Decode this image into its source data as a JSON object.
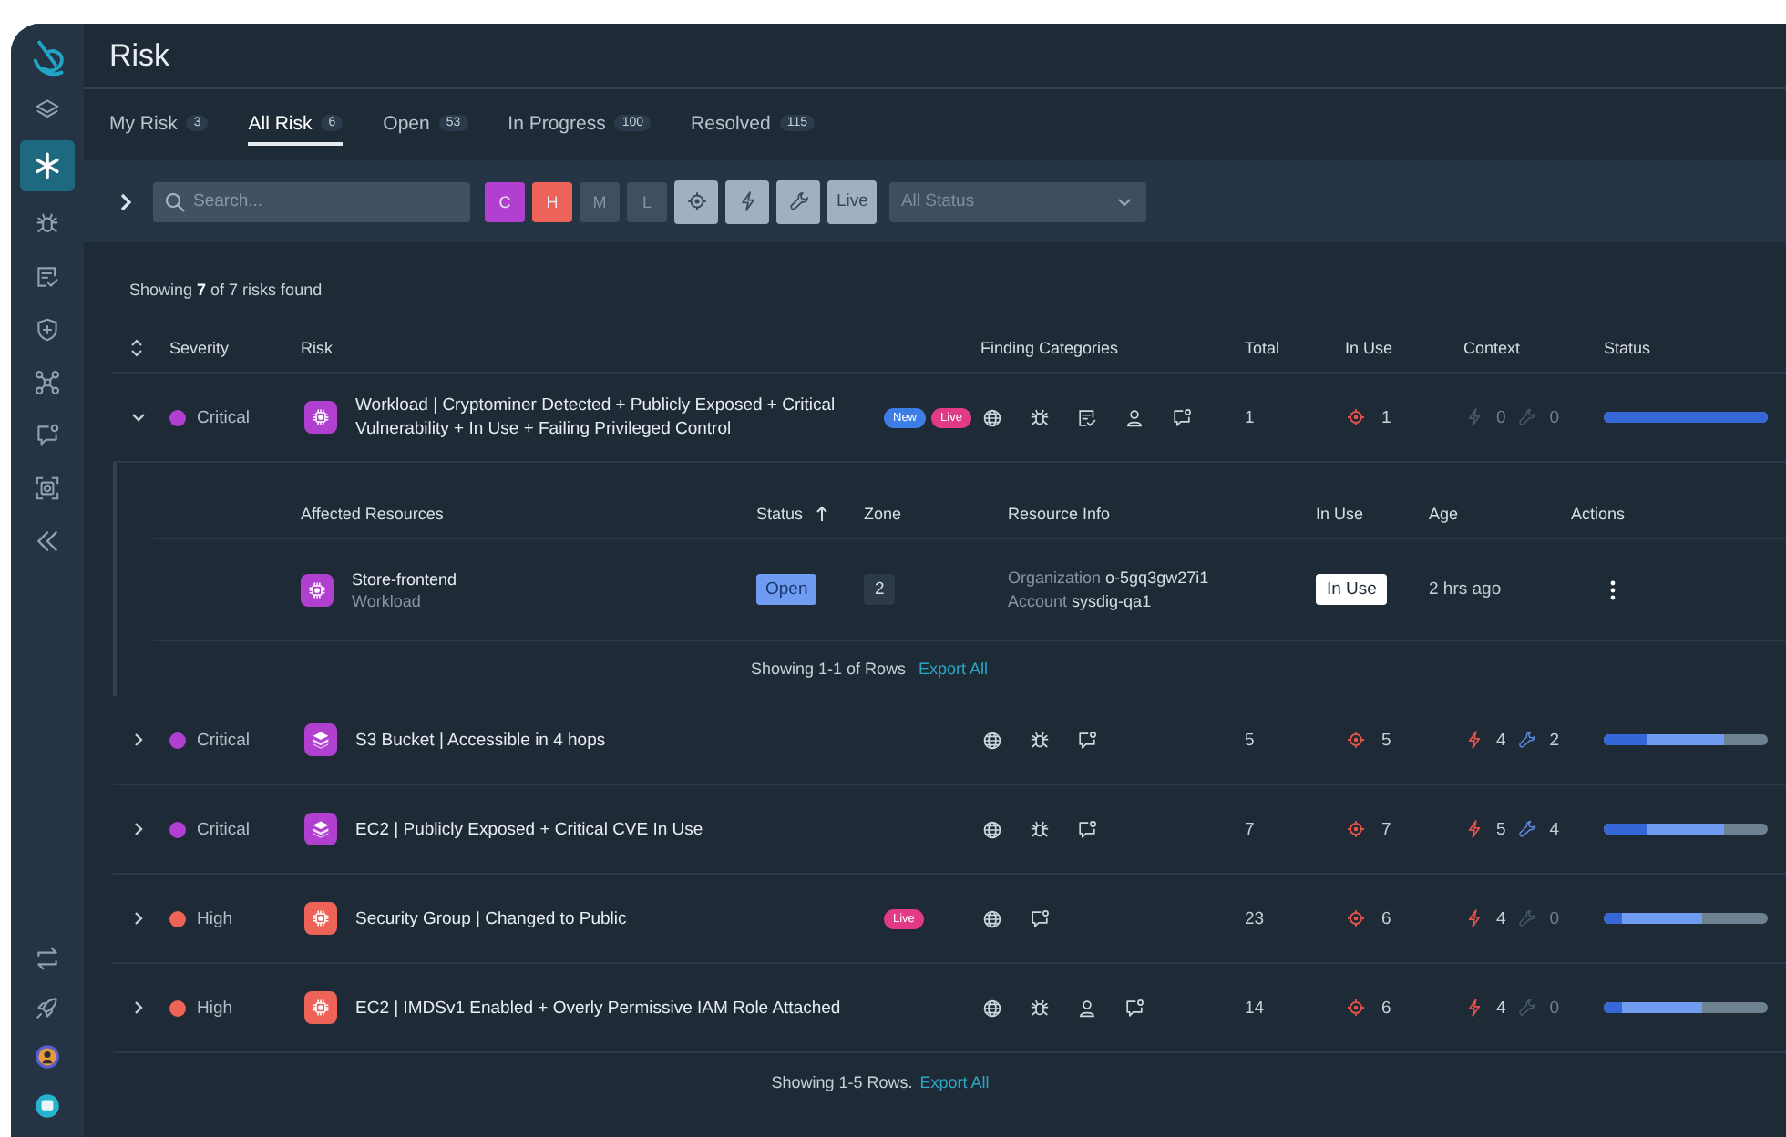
{
  "sidebar": {
    "top_items": [
      {
        "kind": "logo",
        "selected": false
      },
      {
        "kind": "layers",
        "selected": false
      },
      {
        "kind": "asterisk",
        "selected": true
      },
      {
        "kind": "bug",
        "selected": false
      },
      {
        "kind": "checklist",
        "selected": false
      },
      {
        "kind": "shield",
        "selected": false
      },
      {
        "kind": "network",
        "selected": false
      },
      {
        "kind": "chat",
        "selected": false
      },
      {
        "kind": "scan",
        "selected": false
      },
      {
        "kind": "collapse",
        "selected": false
      }
    ],
    "bottom_items": [
      {
        "kind": "swap",
        "selected": false
      },
      {
        "kind": "rocket",
        "selected": false
      },
      {
        "kind": "avatar",
        "selected": false
      },
      {
        "kind": "help",
        "selected": false
      }
    ]
  },
  "page": {
    "title": "Risk"
  },
  "tabs": [
    {
      "label": "My Risk",
      "count": "3",
      "selected": false
    },
    {
      "label": "All Risk",
      "count": "6",
      "selected": true
    },
    {
      "label": "Open",
      "count": "53",
      "selected": false
    },
    {
      "label": "In Progress",
      "count": "100",
      "selected": false
    },
    {
      "label": "Resolved",
      "count": "115",
      "selected": false
    }
  ],
  "filters": {
    "search": {
      "placeholder": "Search..."
    },
    "severity": [
      {
        "label": "C",
        "color": "#b140d0",
        "selected": true
      },
      {
        "label": "H",
        "color": "#ee6357",
        "selected": true
      },
      {
        "label": "M",
        "color": "#3f4f61",
        "selected": false
      },
      {
        "label": "L",
        "color": "#3f4f61",
        "selected": false
      }
    ],
    "toggles": [
      {
        "kind": "target",
        "selected": true
      },
      {
        "kind": "bolt",
        "selected": true
      },
      {
        "kind": "wrench",
        "selected": true
      },
      {
        "kind": "text",
        "label": "Live",
        "selected": true
      }
    ],
    "status": {
      "placeholder": "All Status"
    }
  },
  "summary": {
    "text": "Showing **7** of 7 risks found"
  },
  "table": {
    "columns": [
      "Severity",
      "Risk",
      "Finding Categories",
      "Total",
      "In Use",
      "Context",
      "Status"
    ],
    "rows": [
      {
        "expanded": true,
        "severity": "Critical",
        "color": "#b140d0",
        "kind": "chip",
        "title": "Workload | Cryptominer Detected + Publicly Exposed + Critical Vulnerability + In Use + Failing Privileged Control",
        "badges": [
          {
            "kind": "new",
            "label": "New"
          },
          {
            "kind": "live",
            "label": "Live"
          }
        ],
        "categories": [
          {
            "kind": "globe"
          },
          {
            "kind": "bug"
          },
          {
            "kind": "checklist"
          },
          {
            "kind": "person"
          },
          {
            "kind": "chat"
          }
        ],
        "total": "1",
        "in_use": "1",
        "context": [
          {
            "kind": "bolt",
            "count": "0",
            "active": false
          },
          {
            "kind": "wrench",
            "count": "0",
            "active": false
          }
        ],
        "status": [
          {
            "level": 1.0
          },
          {
            "level": 1.0
          }
        ],
        "details": {
          "columns": [
            {
              "label": "Affected Resources",
              "sorted": false
            },
            {
              "label": "Status",
              "sorted": true
            },
            {
              "label": "Zone",
              "sorted": false
            },
            {
              "label": "Resource Info",
              "sorted": false
            },
            {
              "label": "In Use",
              "sorted": false
            },
            {
              "label": "Age",
              "sorted": false
            },
            {
              "label": "Actions",
              "sorted": false
            }
          ],
          "rows": [
            {
              "name": "Store-frontend",
              "type": "Workload",
              "status": "Open",
              "zone": "2",
              "info": [
                {
                  "label": "Organization",
                  "value": "o-5gq3gw27i1"
                },
                {
                  "label": "Account",
                  "value": "sysdig-qa1"
                }
              ],
              "in_use": "In Use",
              "age": "2 hrs ago"
            }
          ],
          "footer": "Showing 1-1 of Rows",
          "export": "Export All"
        }
      },
      {
        "expanded": false,
        "severity": "Critical",
        "color": "#b140d0",
        "kind": "stack",
        "title": "S3 Bucket | Accessible in 4 hops",
        "badges": [],
        "categories": [
          {
            "kind": "globe"
          },
          {
            "kind": "bug"
          },
          {
            "kind": "chat"
          }
        ],
        "total": "5",
        "in_use": "5",
        "context": [
          {
            "kind": "bolt",
            "count": "4",
            "active": true
          },
          {
            "kind": "wrench",
            "count": "2",
            "active": true
          }
        ],
        "status": [
          {
            "level": 0.27
          },
          {
            "level": 0.73
          }
        ]
      },
      {
        "expanded": false,
        "severity": "Critical",
        "color": "#b140d0",
        "kind": "stack",
        "title": "EC2 | Publicly Exposed + Critical CVE In Use",
        "badges": [],
        "categories": [
          {
            "kind": "globe"
          },
          {
            "kind": "bug"
          },
          {
            "kind": "chat"
          }
        ],
        "total": "7",
        "in_use": "7",
        "context": [
          {
            "kind": "bolt",
            "count": "5",
            "active": true
          },
          {
            "kind": "wrench",
            "count": "4",
            "active": true
          }
        ],
        "status": [
          {
            "level": 0.27
          },
          {
            "level": 0.73
          }
        ]
      },
      {
        "expanded": false,
        "severity": "High",
        "color": "#ee6357",
        "kind": "chip",
        "title": "Security Group | Changed to Public",
        "badges": [
          {
            "kind": "live",
            "label": "Live"
          }
        ],
        "categories": [
          {
            "kind": "globe"
          },
          {
            "kind": "chat"
          }
        ],
        "total": "23",
        "in_use": "6",
        "context": [
          {
            "kind": "bolt",
            "count": "4",
            "active": true
          },
          {
            "kind": "wrench",
            "count": "0",
            "active": false
          }
        ],
        "status": [
          {
            "level": 0.11
          },
          {
            "level": 0.6
          }
        ]
      },
      {
        "expanded": false,
        "severity": "High",
        "color": "#ee6357",
        "kind": "chip",
        "title": "EC2 | IMDSv1 Enabled + Overly Permissive IAM Role Attached",
        "badges": [],
        "categories": [
          {
            "kind": "globe"
          },
          {
            "kind": "bug"
          },
          {
            "kind": "person"
          },
          {
            "kind": "chat"
          }
        ],
        "total": "14",
        "in_use": "6",
        "context": [
          {
            "kind": "bolt",
            "count": "4",
            "active": true
          },
          {
            "kind": "wrench",
            "count": "0",
            "active": false
          }
        ],
        "status": [
          {
            "level": 0.11
          },
          {
            "level": 0.6
          }
        ]
      }
    ],
    "footer": "Showing 1-5 Rows.",
    "export": "Export All"
  }
}
